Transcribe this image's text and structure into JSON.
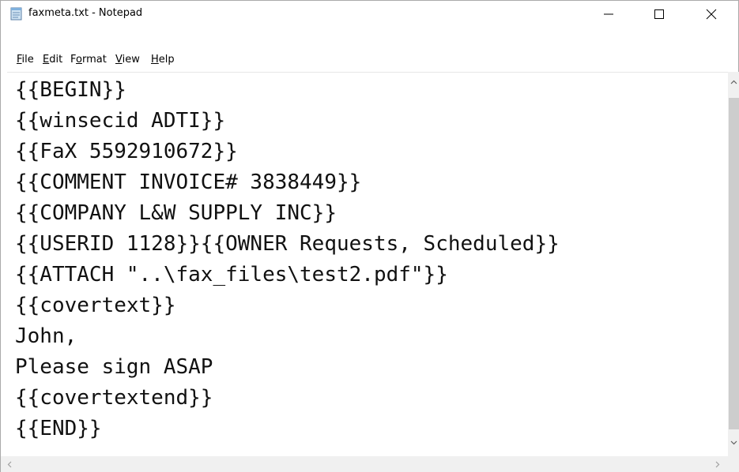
{
  "window": {
    "title": "faxmeta.txt - Notepad",
    "app_icon": "notepad-icon"
  },
  "controls": {
    "minimize_icon": "minimize-icon",
    "maximize_icon": "maximize-icon",
    "close_icon": "close-icon"
  },
  "menu": {
    "file": {
      "accel": "F",
      "rest": "ile"
    },
    "edit": {
      "accel": "E",
      "rest": "dit"
    },
    "format": {
      "pre": "F",
      "accel": "o",
      "rest": "rmat"
    },
    "view": {
      "accel": "V",
      "rest": "iew"
    },
    "help": {
      "accel": "H",
      "rest": "elp"
    }
  },
  "document": {
    "lines": [
      "{{BEGIN}}",
      "{{winsecid ADTI}}",
      "{{FaX 5592910672}}",
      "{{COMMENT INVOICE# 3838449}}",
      "{{COMPANY L&W SUPPLY INC}}",
      "{{USERID 1128}}{{OWNER Requests, Scheduled}}",
      "{{ATTACH \"..\\fax_files\\test2.pdf\"}}",
      "{{covertext}}",
      "John,",
      "Please sign ASAP",
      "{{covertextend}}",
      "{{END}}"
    ]
  },
  "colors": {
    "scrollbar_track": "#f0f0f0",
    "scrollbar_thumb": "#cdcdcd",
    "text": "#111111"
  }
}
